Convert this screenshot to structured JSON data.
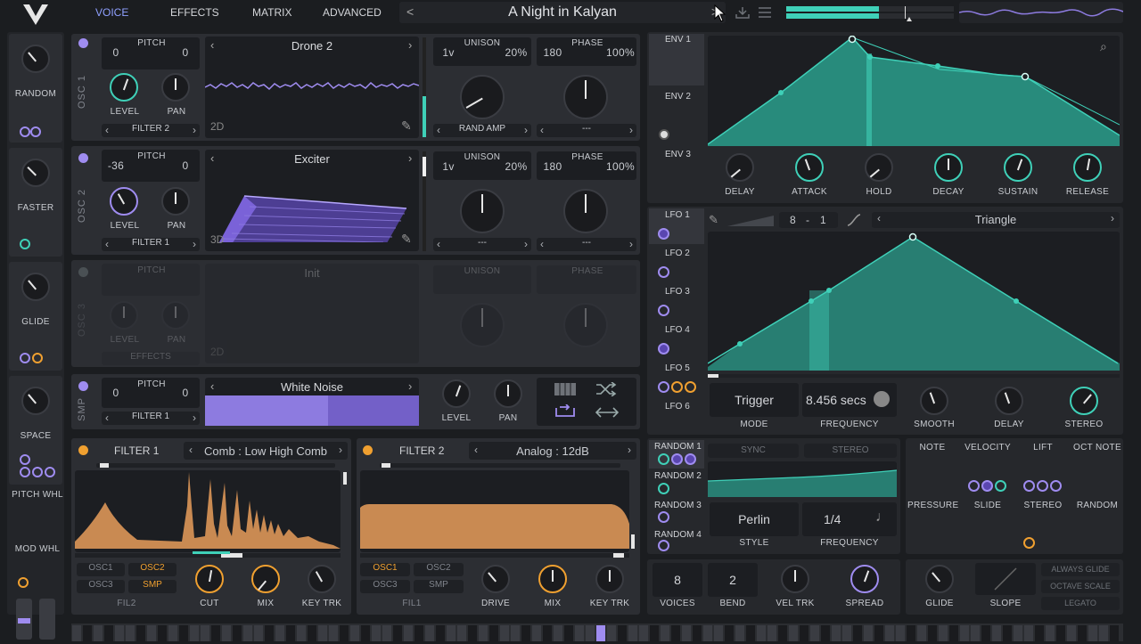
{
  "header": {
    "tabs": [
      "VOICE",
      "EFFECTS",
      "MATRIX",
      "ADVANCED"
    ],
    "active_tab": "VOICE",
    "preset_name": "A Night in Kalyan",
    "prev": "<",
    "next": ">"
  },
  "macros": [
    {
      "label": "RANDOM"
    },
    {
      "label": "FASTER"
    },
    {
      "label": "GLIDE"
    },
    {
      "label": "SPACE"
    }
  ],
  "left_labels": {
    "pitch_wheel": "PITCH WHL",
    "mod_wheel": "MOD WHL"
  },
  "osc": [
    {
      "name": "OSC 1",
      "pitch_label": "PITCH",
      "pitch_a": "0",
      "pitch_b": "0",
      "level_label": "LEVEL",
      "pan_label": "PAN",
      "filter_label": "FILTER 2",
      "wavetable": "Drone 2",
      "dim": "2D",
      "unison_label": "UNISON",
      "unison_voices": "1v",
      "unison_detune": "20%",
      "phase_label": "PHASE",
      "phase_val": "180",
      "phase_rand": "100%",
      "sel1": "RAND AMP",
      "sel2": "---"
    },
    {
      "name": "OSC 2",
      "pitch_label": "PITCH",
      "pitch_a": "-36",
      "pitch_b": "0",
      "level_label": "LEVEL",
      "pan_label": "PAN",
      "filter_label": "FILTER 1",
      "wavetable": "Exciter",
      "dim": "3D",
      "unison_label": "UNISON",
      "unison_voices": "1v",
      "unison_detune": "20%",
      "phase_label": "PHASE",
      "phase_val": "180",
      "phase_rand": "100%",
      "sel1": "---",
      "sel2": "---"
    },
    {
      "name": "OSC 3",
      "pitch_label": "PITCH",
      "pitch_a": "0",
      "pitch_b": "0",
      "level_label": "LEVEL",
      "pan_label": "PAN",
      "filter_label": "EFFECTS",
      "wavetable": "Init",
      "dim": "2D",
      "unison_label": "UNISON",
      "unison_voices": "1v",
      "unison_detune": "20%",
      "phase_label": "PHASE",
      "phase_val": "180",
      "phase_rand": "100%",
      "sel1": "---",
      "sel2": "---"
    }
  ],
  "smp": {
    "name": "SMP",
    "pitch_label": "PITCH",
    "pitch_a": "0",
    "pitch_b": "0",
    "filter_label": "FILTER 1",
    "sample": "White Noise",
    "level_label": "LEVEL",
    "pan_label": "PAN"
  },
  "filter1": {
    "title": "FILTER 1",
    "type": "Comb : Low High Comb",
    "routes": [
      "OSC1",
      "OSC2",
      "OSC3",
      "SMP"
    ],
    "route_bottom": "FIL2",
    "knobs": [
      "CUT",
      "MIX",
      "KEY TRK"
    ]
  },
  "filter2": {
    "title": "FILTER 2",
    "type": "Analog : 12dB",
    "routes": [
      "OSC1",
      "OSC2",
      "OSC3",
      "SMP"
    ],
    "route_bottom": "FIL1",
    "knobs": [
      "DRIVE",
      "MIX",
      "KEY TRK"
    ]
  },
  "env": {
    "tabs": [
      "ENV 1",
      "ENV 2",
      "ENV 3"
    ],
    "knobs": [
      "DELAY",
      "ATTACK",
      "HOLD",
      "DECAY",
      "SUSTAIN",
      "RELEASE"
    ]
  },
  "lfo": {
    "tabs": [
      "LFO 1",
      "LFO 2",
      "LFO 3",
      "LFO 4",
      "LFO 5",
      "LFO 6"
    ],
    "grid_a": "8",
    "grid_sep": "-",
    "grid_b": "1",
    "shape": "Triangle",
    "mode_val": "Trigger",
    "mode_label": "MODE",
    "freq_val": "8.456 secs",
    "freq_label": "FREQUENCY",
    "knobs": [
      "SMOOTH",
      "DELAY",
      "STEREO"
    ]
  },
  "random": {
    "tabs": [
      "RANDOM 1",
      "RANDOM 2",
      "RANDOM 3",
      "RANDOM 4"
    ],
    "sync": "SYNC",
    "stereo": "STEREO",
    "style_val": "Perlin",
    "style_label": "STYLE",
    "freq_val": "1/4",
    "freq_label": "FREQUENCY"
  },
  "mod_sources": [
    "NOTE",
    "VELOCITY",
    "LIFT",
    "OCT NOTE",
    "PRESSURE",
    "SLIDE",
    "STEREO",
    "RANDOM"
  ],
  "voice": {
    "voices": "8",
    "voices_label": "VOICES",
    "bend": "2",
    "bend_label": "BEND",
    "vel_label": "VEL TRK",
    "spread_label": "SPREAD"
  },
  "glide": {
    "glide_label": "GLIDE",
    "slope_label": "SLOPE",
    "always": "ALWAYS GLIDE",
    "octave": "OCTAVE SCALE",
    "legato": "LEGATO"
  },
  "colors": {
    "accent": "#3fd0b8",
    "purple": "#9f8cf0",
    "orange": "#f0a030",
    "filter_fill": "#c98a52"
  }
}
